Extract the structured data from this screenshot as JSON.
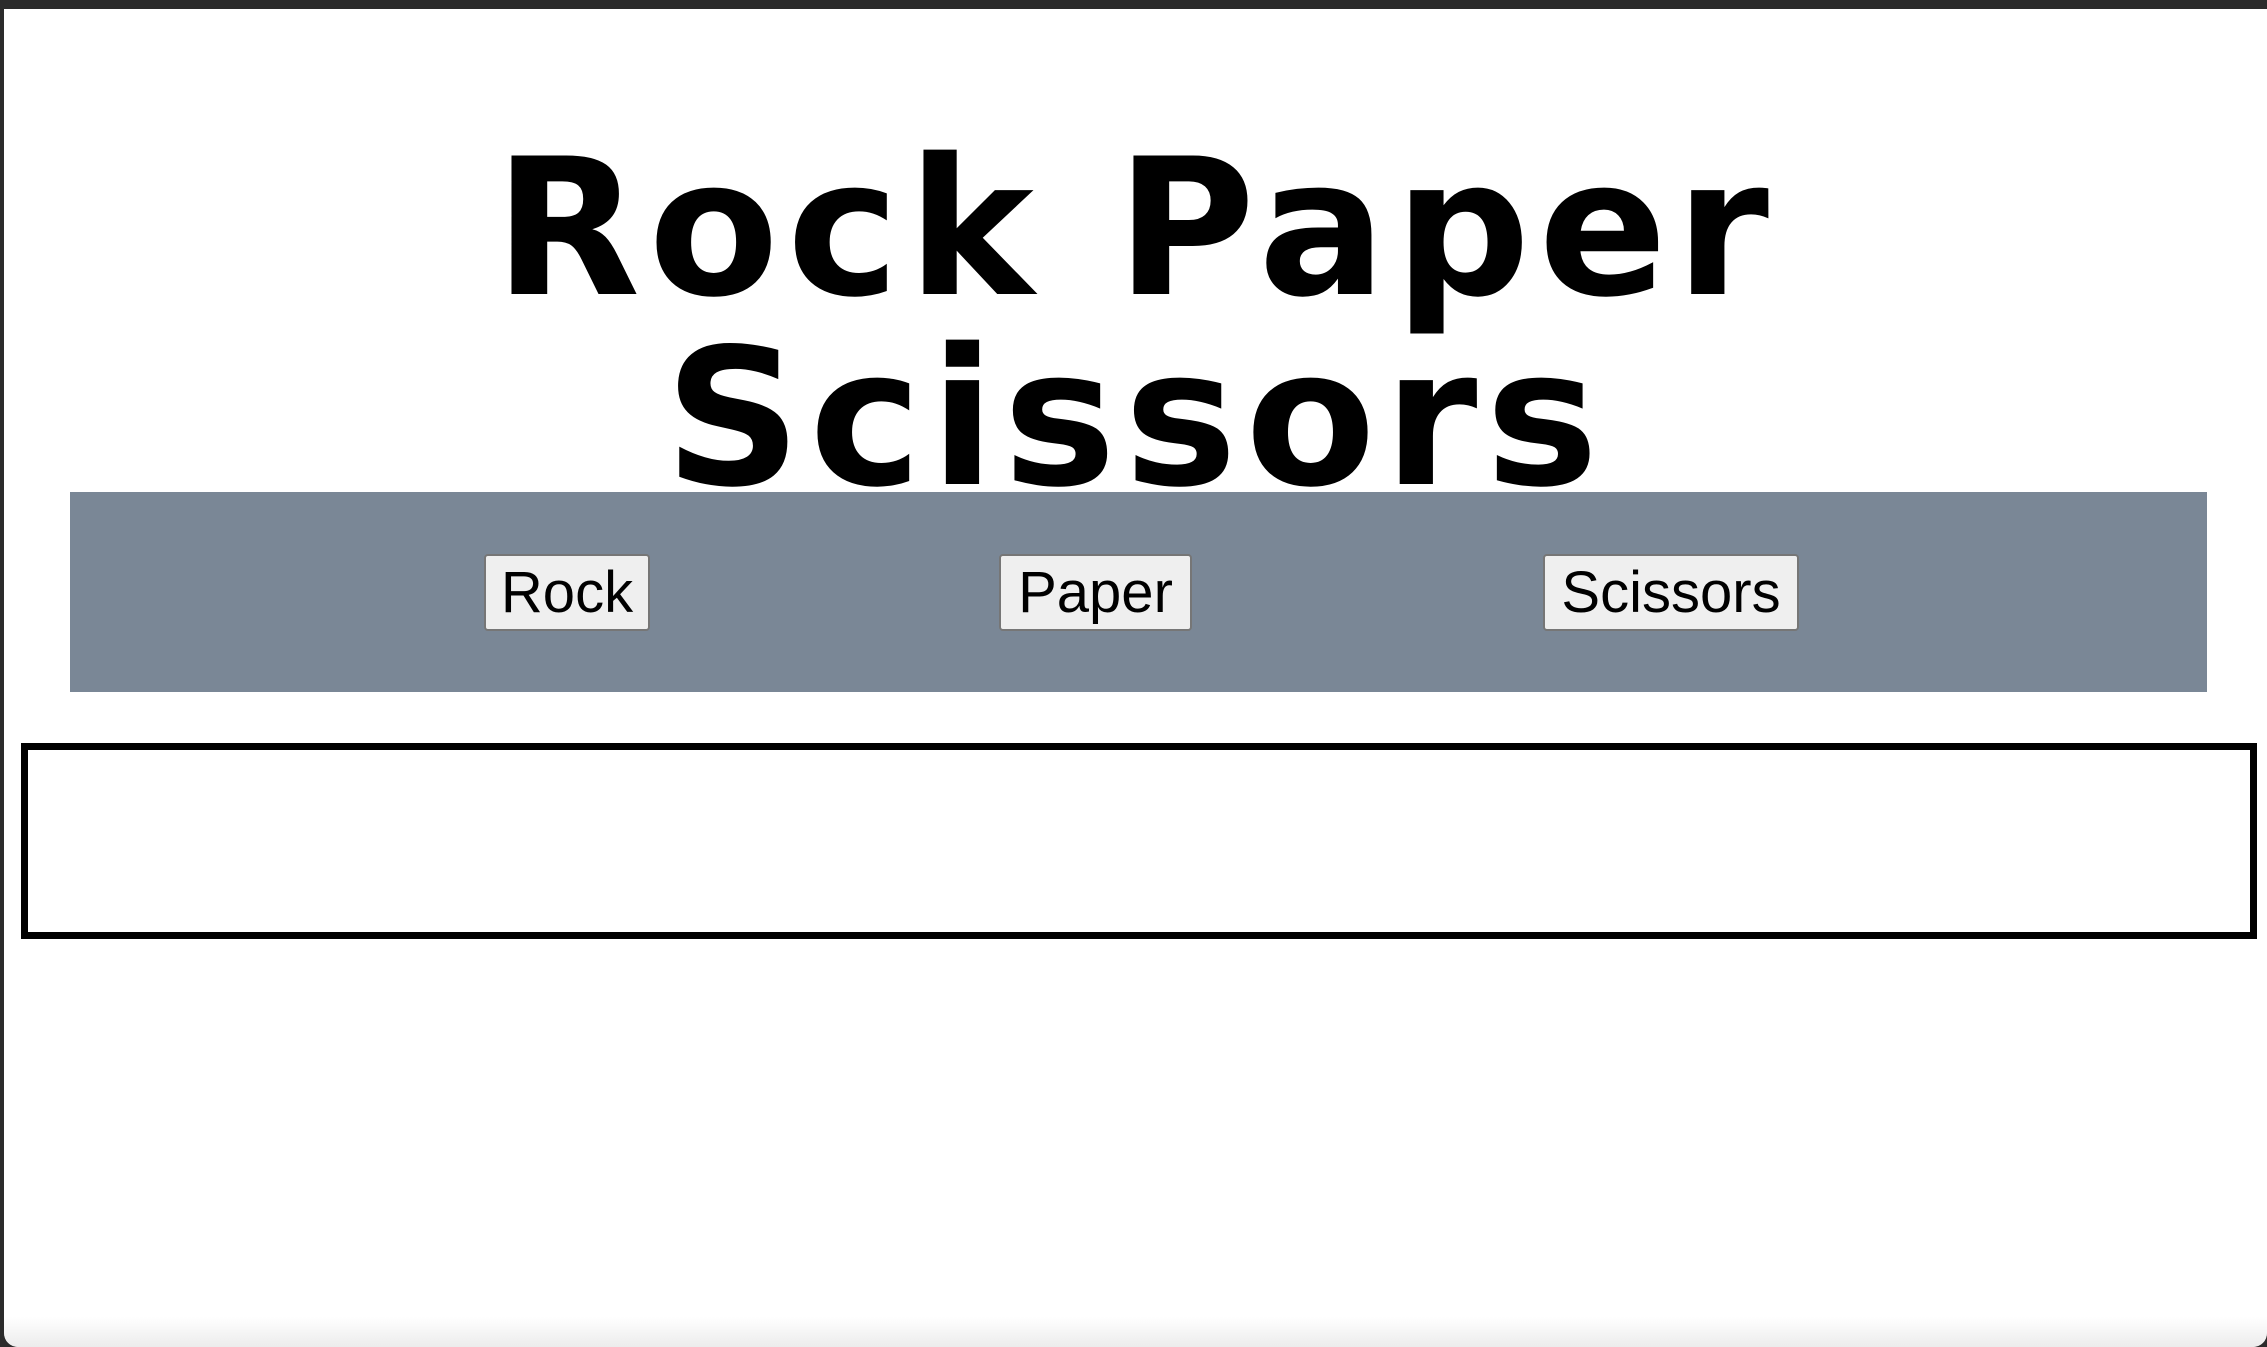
{
  "page": {
    "title": "Rock Paper Scissors"
  },
  "controls": {
    "rock_label": "Rock",
    "paper_label": "Paper",
    "scissors_label": "Scissors",
    "panel_color": "#7a8796"
  },
  "result": {
    "text": ""
  }
}
